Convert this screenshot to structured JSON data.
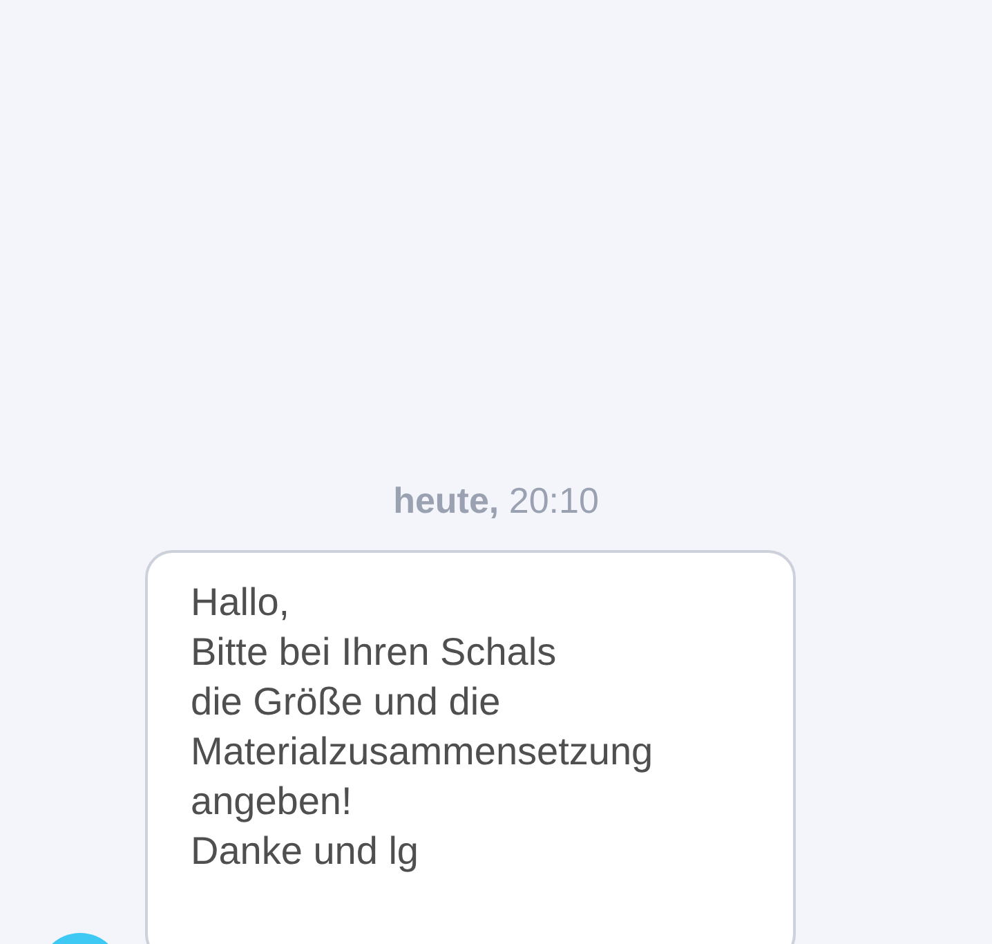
{
  "timestamp": "**heute,** 20:10",
  "message": {
    "text": "Hallo,\nBitte bei Ihren Schals\ndie Größe und die\nMaterialzusammensetzung\nangeben!\nDanke und lg"
  }
}
